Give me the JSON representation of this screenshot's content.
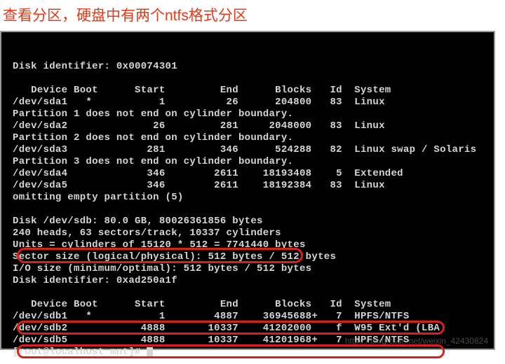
{
  "caption": "查看分区，硬盘中有两个ntfs格式分区",
  "term": {
    "blank1": "",
    "line1": "Disk identifier: 0x00074301",
    "blank2": "",
    "header1": "   Device Boot      Start         End      Blocks   Id  System",
    "sda1": "/dev/sda1   *           1          26      204800   83  Linux",
    "pw1": "Partition 1 does not end on cylinder boundary.",
    "sda2": "/dev/sda2              26         281     2048000   83  Linux",
    "pw2": "Partition 2 does not end on cylinder boundary.",
    "sda3": "/dev/sda3             281         346      524288   82  Linux swap / Solaris",
    "pw3": "Partition 3 does not end on cylinder boundary.",
    "sda4": "/dev/sda4             346        2611    18193408    5  Extended",
    "sda5": "/dev/sda5             346        2611    18192384   83  Linux",
    "omit": "omitting empty partition (5)",
    "blank3": "",
    "disk2": "Disk /dev/sdb: 80.0 GB, 80026361856 bytes",
    "geo": "240 heads, 63 sectors/track, 10337 cylinders",
    "units": "Units = cylinders of 15120 * 512 = 7741440 bytes",
    "sector": "Sector size (logical/physical): 512 bytes / 512 bytes",
    "io": "I/O size (minimum/optimal): 512 bytes / 512 bytes",
    "diskid2": "Disk identifier: 0xad250a1f",
    "blank4": "",
    "header2": "   Device Boot      Start         End      Blocks   Id  System",
    "sdb1": "/dev/sdb1   *           1        4887    36945688+   7  HPFS/NTFS",
    "sdb2": "/dev/sdb2            4888       10337    41202000    f  W95 Ext'd (LBA)",
    "sdb5": "/dev/sdb5            4888       10337    41201968+   7  HPFS/NTFS",
    "prompt": "[root@localhost mnt]# "
  },
  "watermark": "https://blog.csdn.net/weixin_42430824"
}
